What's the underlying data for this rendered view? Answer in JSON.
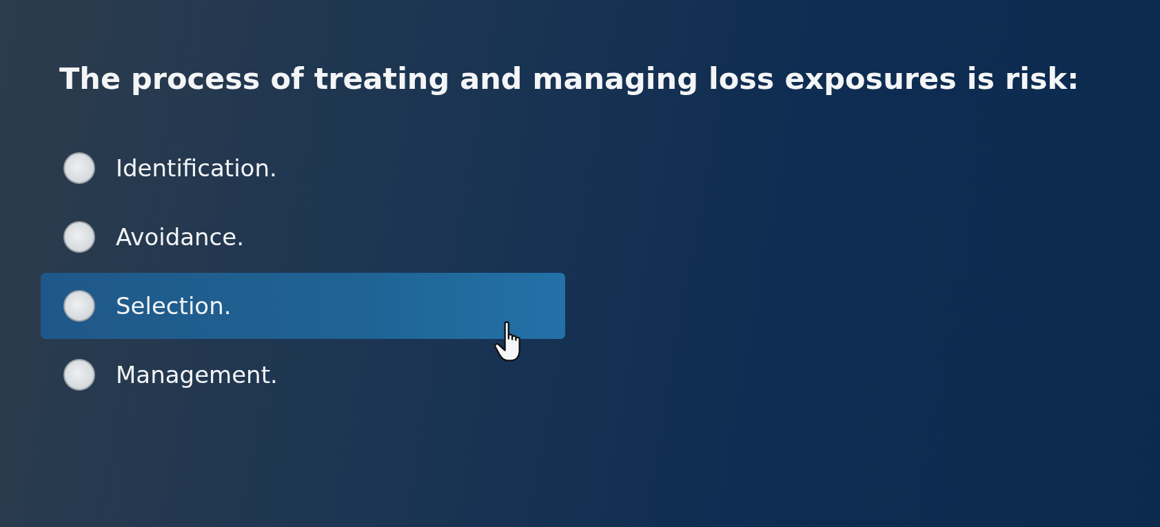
{
  "question": {
    "text": "The process of treating and managing loss exposures is risk:"
  },
  "options": [
    {
      "label": "Identification.",
      "selected": false,
      "highlighted": false
    },
    {
      "label": "Avoidance.",
      "selected": false,
      "highlighted": false
    },
    {
      "label": "Selection.",
      "selected": false,
      "highlighted": true
    },
    {
      "label": "Management.",
      "selected": false,
      "highlighted": false
    }
  ]
}
